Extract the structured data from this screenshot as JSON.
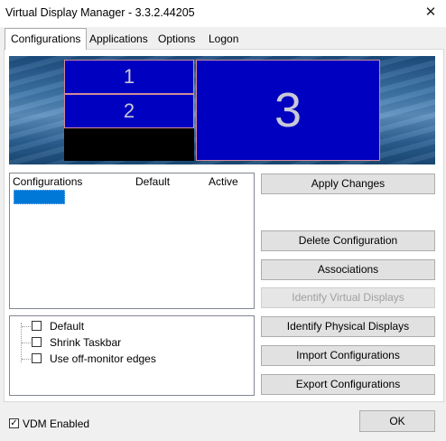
{
  "window": {
    "title": "Virtual Display Manager - 3.3.2.44205",
    "close_glyph": "✕"
  },
  "tabs": [
    {
      "label": "Configurations",
      "active": true
    },
    {
      "label": "Applications",
      "active": false
    },
    {
      "label": "Options",
      "active": false
    },
    {
      "label": "Logon",
      "active": false
    }
  ],
  "preview": {
    "monitors": [
      "1",
      "2",
      "3"
    ]
  },
  "config_list": {
    "columns": [
      "Configurations",
      "Default",
      "Active"
    ],
    "rows": [
      {
        "name": "",
        "selected": true
      }
    ]
  },
  "options": [
    {
      "label": "Default",
      "checked": false
    },
    {
      "label": "Shrink Taskbar",
      "checked": false
    },
    {
      "label": "Use off-monitor edges",
      "checked": false
    }
  ],
  "buttons": {
    "apply": "Apply Changes",
    "delete": "Delete Configuration",
    "associations": "Associations",
    "identify_virtual": "Identify Virtual Displays",
    "identify_physical": "Identify Physical Displays",
    "import": "Import Configurations",
    "export": "Export Configurations",
    "ok": "OK"
  },
  "footer": {
    "vdm_enabled_label": "VDM Enabled",
    "vdm_enabled": true,
    "check_glyph": "✓"
  },
  "colors": {
    "monitor": "#0000c0",
    "selection": "#0078d7"
  }
}
